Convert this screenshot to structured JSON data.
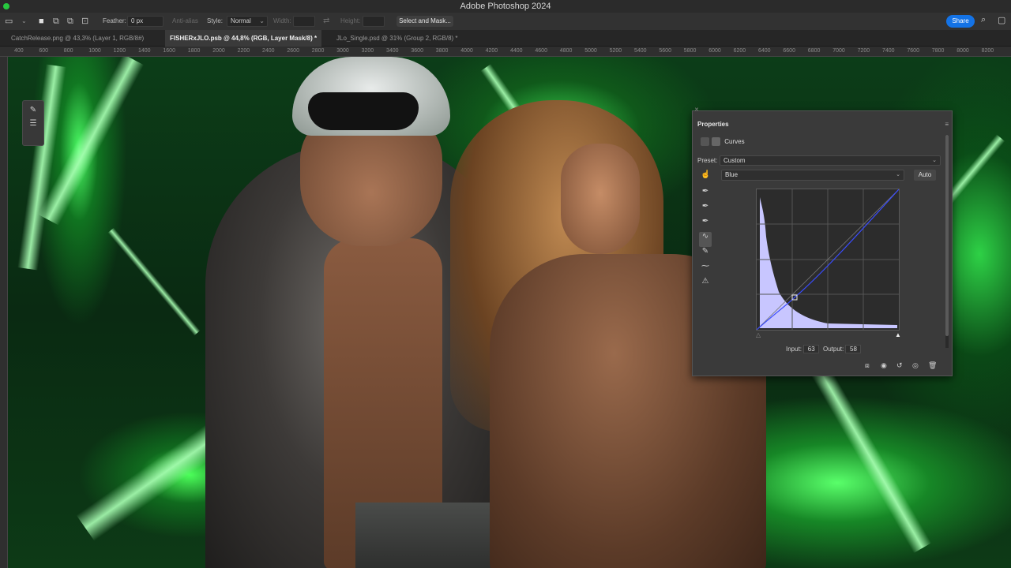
{
  "app": {
    "title": "Adobe Photoshop 2024"
  },
  "options": {
    "feather_label": "Feather:",
    "feather_value": "0 px",
    "antialias_label": "Anti-alias",
    "style_label": "Style:",
    "style_value": "Normal",
    "width_label": "Width:",
    "height_label": "Height:",
    "select_mask_label": "Select and Mask...",
    "share_label": "Share"
  },
  "tabs": [
    {
      "label": "CatchRelease.png @ 43,3% (Layer 1, RGB/8#)"
    },
    {
      "label": "FISHERxJLO.psb @ 44,8% (RGB, Layer Mask/8) *"
    },
    {
      "label": "JLo_Single.psd @ 31% (Group 2, RGB/8) *"
    }
  ],
  "ruler": [
    "400",
    "600",
    "800",
    "1000",
    "1200",
    "1400",
    "1600",
    "1800",
    "2000",
    "2200",
    "2400",
    "2600",
    "2800",
    "3000",
    "3200",
    "3400",
    "3600",
    "3800",
    "4000",
    "4200",
    "4400",
    "4600",
    "4800",
    "5000",
    "5200",
    "5400",
    "5600",
    "5800",
    "6000",
    "6200",
    "6400",
    "6600",
    "6800",
    "7000",
    "7200",
    "7400",
    "7600",
    "7800",
    "8000",
    "8200"
  ],
  "properties": {
    "title": "Properties",
    "adjustment": "Curves",
    "preset_label": "Preset:",
    "preset_value": "Custom",
    "channel_value": "Blue",
    "auto_label": "Auto",
    "input_label": "Input:",
    "input_value": "63",
    "output_label": "Output:",
    "output_value": "58"
  },
  "colors": {
    "accent": "#1473e6",
    "panel_bg": "#3a3a3a",
    "curve": "#3a4cff",
    "histogram": "#c8c6ff"
  },
  "icons": [
    "marquee-tool-icon",
    "new-selection-icon",
    "add-selection-icon",
    "subtract-selection-icon",
    "swap-icon",
    "search-icon",
    "workspace-icon",
    "brush-icon",
    "sliders-icon",
    "curves-icon",
    "mask-icon",
    "hand-target-icon",
    "eyedropper-black-icon",
    "eyedropper-gray-icon",
    "eyedropper-white-icon",
    "curve-point-icon",
    "pencil-icon",
    "smooth-icon",
    "clipping-warning-icon",
    "clip-layer-icon",
    "visibility-icon",
    "reset-icon",
    "eye-icon",
    "trash-icon"
  ]
}
